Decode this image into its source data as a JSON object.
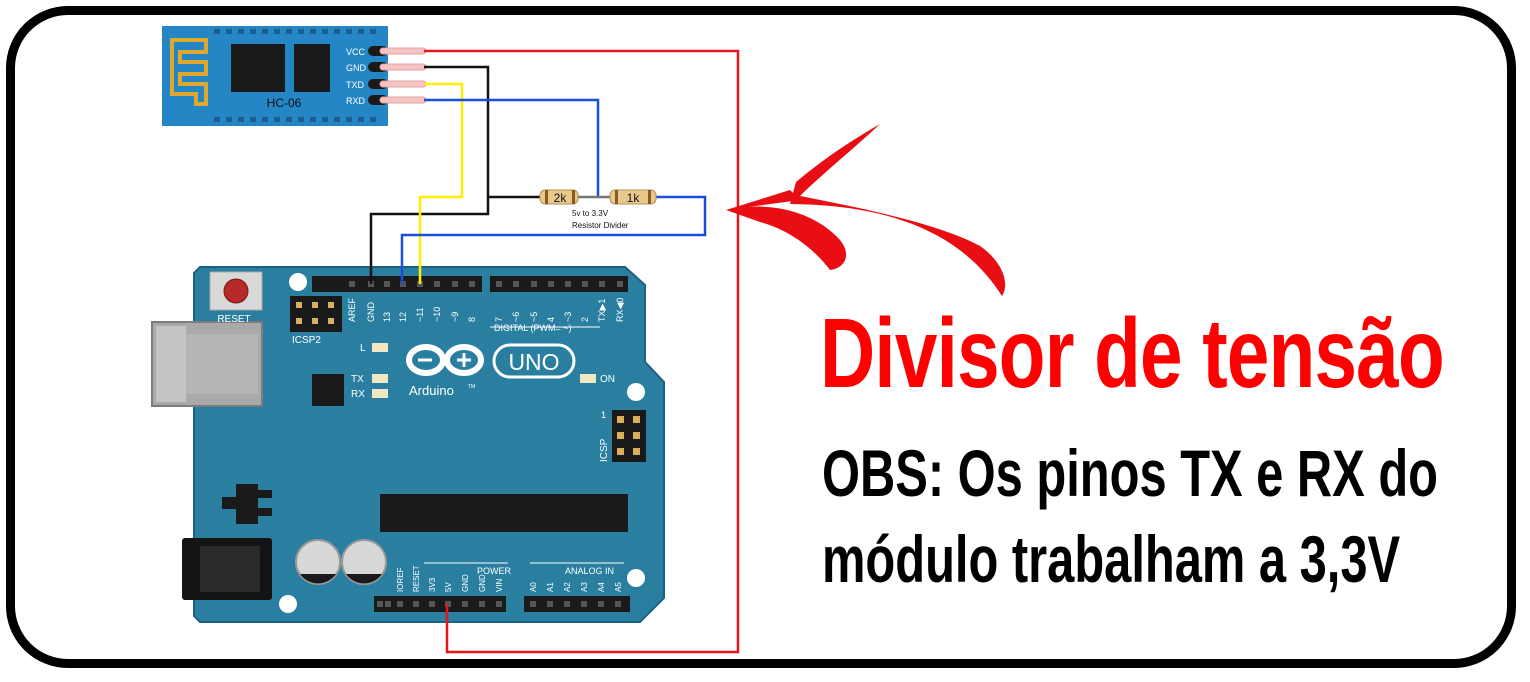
{
  "title": "Divisor de tensão",
  "note_line1": "OBS: Os pinos TX e RX do",
  "note_line2": "módulo trabalham a 3,3V",
  "module": {
    "name": "HC-06",
    "pins": [
      "VCC",
      "GND",
      "TXD",
      "RXD"
    ]
  },
  "resistors": {
    "r1": "2k",
    "r2": "1k",
    "caption_line1": "5v to 3.3V",
    "caption_line2": "Resistor Divider"
  },
  "arduino": {
    "reset_label": "RESET",
    "icsp2_label": "ICSP2",
    "icsp_label": "ICSP",
    "icsp_pin1": "1",
    "logo": "Arduino",
    "model": "UNO",
    "tm": "TM",
    "led_l": "L",
    "led_tx": "TX",
    "led_rx": "RX",
    "led_on": "ON",
    "digital_label": "DIGITAL (PWM= ~)",
    "power_label": "POWER",
    "analog_label": "ANALOG IN",
    "digital_pins": [
      "AREF",
      "GND",
      "13",
      "12",
      "~11",
      "~10",
      "~9",
      "8",
      "7",
      "~6",
      "~5",
      "4",
      "~3",
      "2",
      "TX▶1",
      "RX◀0"
    ],
    "power_pins": [
      "IOREF",
      "RESET",
      "3V3",
      "5V",
      "GND",
      "GND",
      "VIN"
    ],
    "analog_pins": [
      "A0",
      "A1",
      "A2",
      "A3",
      "A4",
      "A5"
    ]
  },
  "colors": {
    "vcc_wire": "#e8141b",
    "gnd_wire": "#111111",
    "txd_wire": "#ffee00",
    "rxd_wire": "#1a4fd6",
    "board": "#2a7fa1",
    "module": "#2486c4",
    "title": "#ff0000"
  }
}
